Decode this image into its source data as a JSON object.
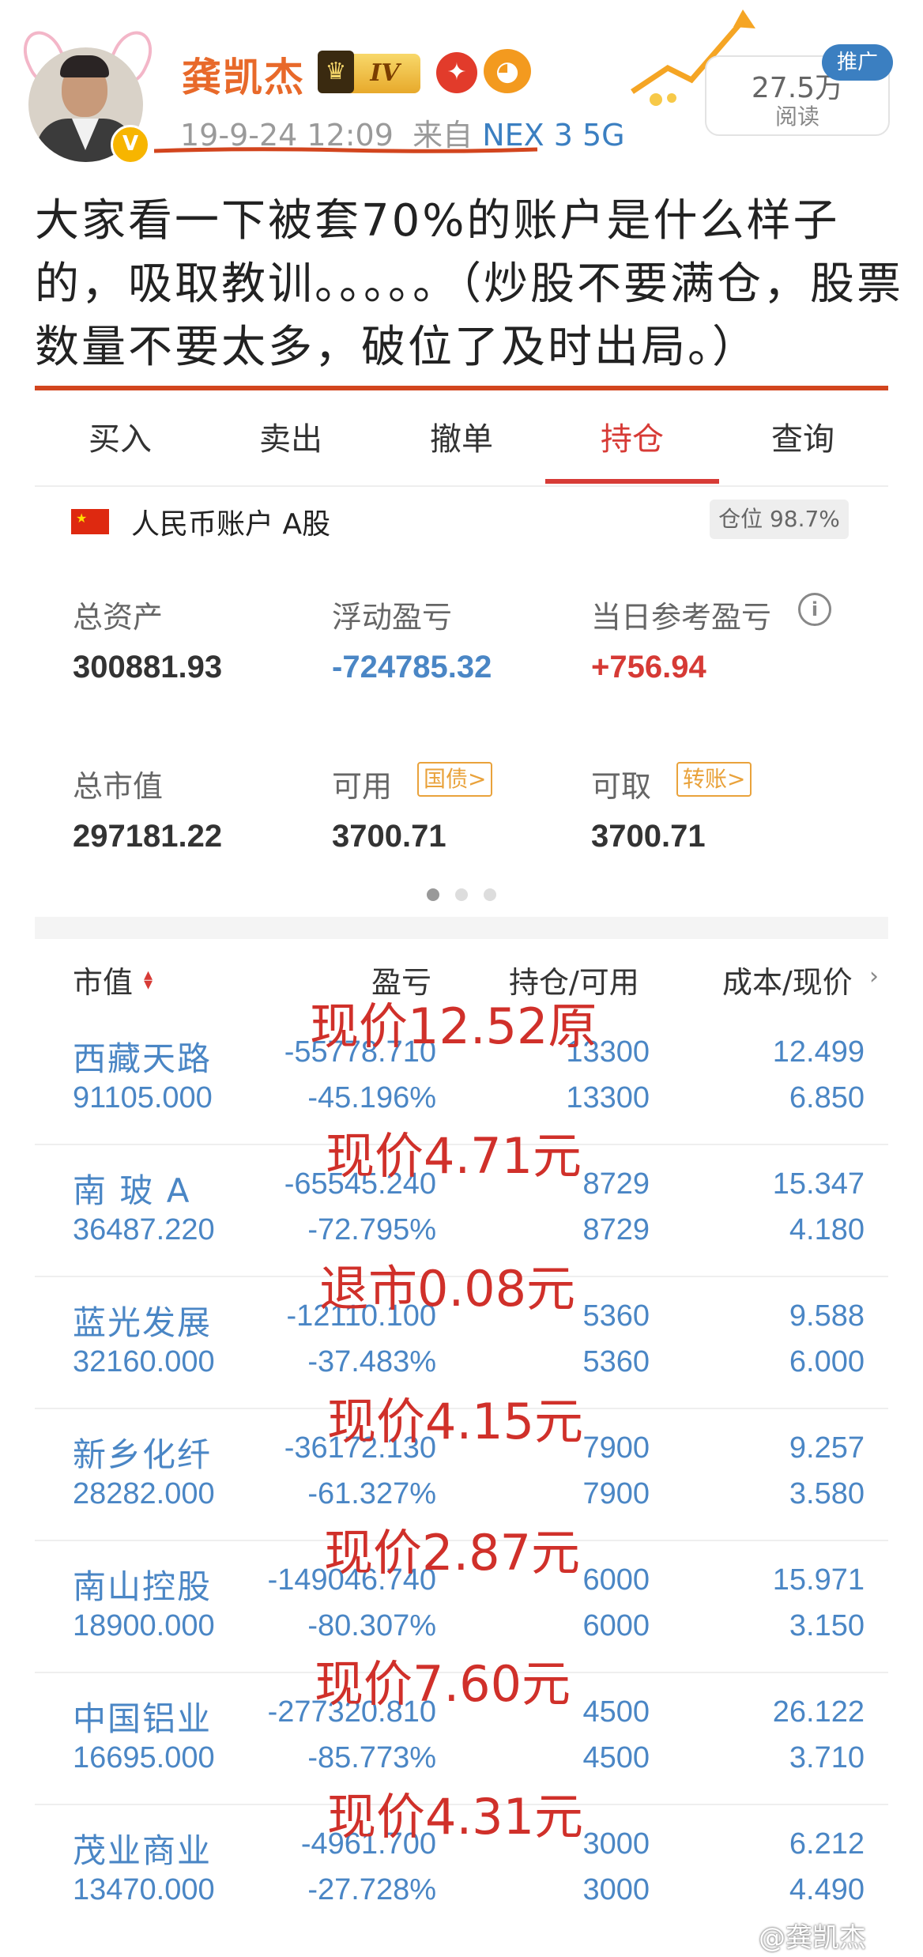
{
  "header": {
    "username": "龚凯杰",
    "vip_level": "IV",
    "timestamp": "19-9-24 12:09",
    "source_prefix": "来自",
    "source_device": "NEX 3 5G",
    "read_count": "27.5万",
    "read_label": "阅读",
    "promo_tag": "推广"
  },
  "post": {
    "text": "大家看一下被套70%的账户是什么样子的，吸取教训。。。。。（炒股不要满仓，股票数量不要太多，破位了及时出局。）"
  },
  "tabs": [
    {
      "label": "买入",
      "active": false
    },
    {
      "label": "卖出",
      "active": false
    },
    {
      "label": "撤单",
      "active": false
    },
    {
      "label": "持仓",
      "active": true
    },
    {
      "label": "查询",
      "active": false
    }
  ],
  "account": {
    "name": "人民币账户 A股",
    "position_ratio": "仓位 98.7%",
    "stats": {
      "total_assets": {
        "label": "总资产",
        "value": "300881.93"
      },
      "floating_pl": {
        "label": "浮动盈亏",
        "value": "-724785.32"
      },
      "daily_pl": {
        "label": "当日参考盈亏",
        "value": "+756.94"
      },
      "market_value": {
        "label": "总市值",
        "value": "297181.22"
      },
      "available": {
        "label": "可用",
        "value": "3700.71",
        "tag": "国债>"
      },
      "withdrawable": {
        "label": "可取",
        "value": "3700.71",
        "tag": "转账>"
      }
    },
    "page_dots": {
      "count": 3,
      "active": 0
    }
  },
  "table": {
    "headers": {
      "col1": "市值",
      "col2": "盈亏",
      "col3": "持仓/可用",
      "col4": "成本/现价"
    },
    "rows": [
      {
        "name": "西藏天路",
        "market_value": "91105.000",
        "pl": "-55778.710",
        "pl_pct": "-45.196%",
        "holding": "13300",
        "available": "13300",
        "cost": "12.499",
        "price": "6.850"
      },
      {
        "name": "南 玻 A",
        "market_value": "36487.220",
        "pl": "-65545.240",
        "pl_pct": "-72.795%",
        "holding": "8729",
        "available": "8729",
        "cost": "15.347",
        "price": "4.180"
      },
      {
        "name": "蓝光发展",
        "market_value": "32160.000",
        "pl": "-12110.100",
        "pl_pct": "-37.483%",
        "holding": "5360",
        "available": "5360",
        "cost": "9.588",
        "price": "6.000"
      },
      {
        "name": "新乡化纤",
        "market_value": "28282.000",
        "pl": "-36172.130",
        "pl_pct": "-61.327%",
        "holding": "7900",
        "available": "7900",
        "cost": "9.257",
        "price": "3.580"
      },
      {
        "name": "南山控股",
        "market_value": "18900.000",
        "pl": "-149046.740",
        "pl_pct": "-80.307%",
        "holding": "6000",
        "available": "6000",
        "cost": "15.971",
        "price": "3.150"
      },
      {
        "name": "中国铝业",
        "market_value": "16695.000",
        "pl": "-277320.810",
        "pl_pct": "-85.773%",
        "holding": "4500",
        "available": "4500",
        "cost": "26.122",
        "price": "3.710"
      },
      {
        "name": "茂业商业",
        "market_value": "13470.000",
        "pl": "-4961.700",
        "pl_pct": "-27.728%",
        "holding": "3000",
        "available": "3000",
        "cost": "6.212",
        "price": "4.490"
      }
    ]
  },
  "annotations": [
    "现价12.52原",
    "现价4.71元",
    "退市0.08元",
    "现价4.15元",
    "现价2.87元",
    "现价7.60元",
    "现价4.31元"
  ],
  "watermark": "@龚凯杰",
  "colors": {
    "username": "#e8692a",
    "accent_red": "#d73b36",
    "value_blue": "#4a86c5",
    "annotation_red": "#d0302a",
    "source_blue": "#3b7fc1"
  }
}
